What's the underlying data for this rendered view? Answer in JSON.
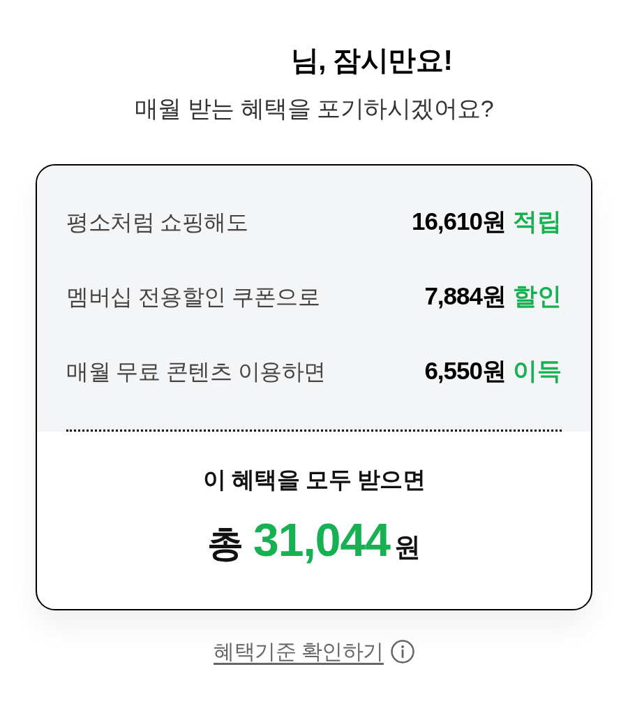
{
  "header": {
    "title": "님, 잠시만요!",
    "subtitle": "매월 받는 혜택을 포기하시겠어요?"
  },
  "benefits": [
    {
      "label": "평소처럼 쇼핑해도",
      "amount": "16,610원",
      "tag": "적립"
    },
    {
      "label": "멤버십 전용할인 쿠폰으로",
      "amount": "7,884원",
      "tag": "할인"
    },
    {
      "label": "매월 무료 콘텐츠 이용하면",
      "amount": "6,550원",
      "tag": "이득"
    }
  ],
  "summary": {
    "caption": "이 혜택을 모두 받으면",
    "prefix": "총",
    "total": "31,044",
    "unit": "원"
  },
  "link": {
    "label": "혜택기준 확인하기"
  }
}
